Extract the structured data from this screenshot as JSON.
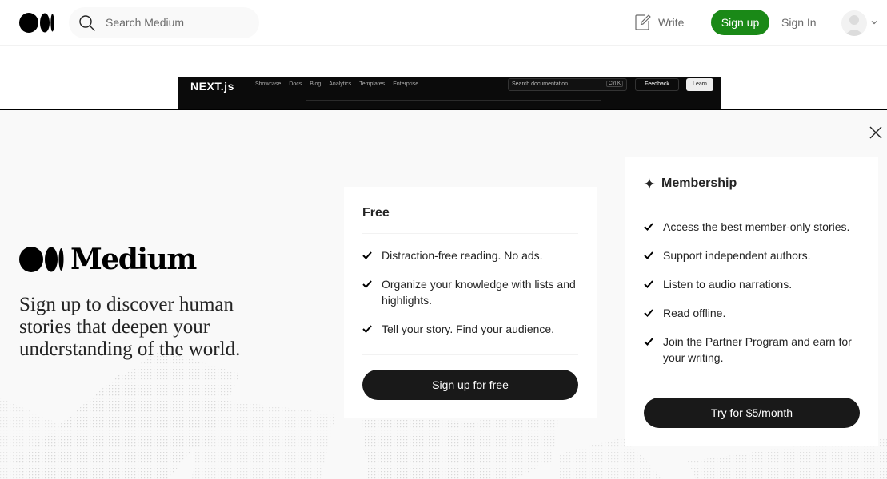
{
  "nav": {
    "search_placeholder": "Search Medium",
    "write_label": "Write",
    "signup_label": "Sign up",
    "signin_label": "Sign In",
    "accent_color": "#1a8917"
  },
  "background_article": {
    "brand": "NEXT.js",
    "links": [
      "Showcase",
      "Docs",
      "Blog",
      "Analytics",
      "Templates",
      "Enterprise"
    ],
    "search_placeholder": "Search documentation...",
    "search_shortcut": "Ctrl K",
    "feedback_label": "Feedback",
    "learn_label": "Learn"
  },
  "modal": {
    "brand": "Medium",
    "tagline": "Sign up to discover human stories that deepen your understanding of the world.",
    "free": {
      "title": "Free",
      "features": [
        "Distraction-free reading. No ads.",
        "Organize your knowledge with lists and highlights.",
        "Tell your story. Find your audience."
      ],
      "cta": "Sign up for free"
    },
    "membership": {
      "title": "Membership",
      "features": [
        "Access the best member-only stories.",
        "Support independent authors.",
        "Listen to audio narrations.",
        "Read offline.",
        "Join the Partner Program and earn for your writing."
      ],
      "cta": "Try for $5/month"
    }
  }
}
